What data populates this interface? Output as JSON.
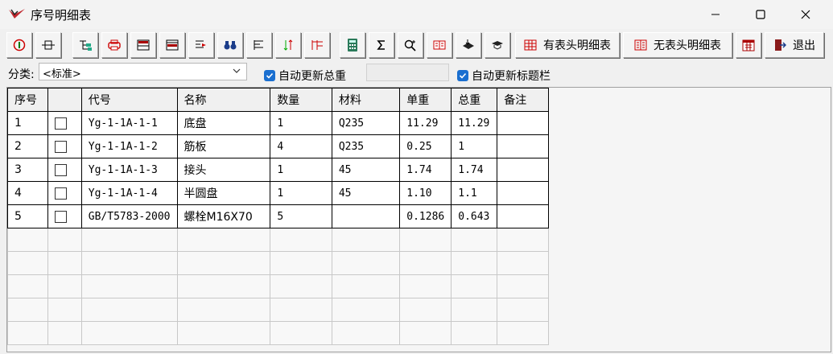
{
  "window": {
    "title": "序号明细表"
  },
  "toolbar": {
    "with_header_label": "有表头明细表",
    "no_header_label": "无表头明细表",
    "exit_label": "退出"
  },
  "filter": {
    "category_label": "分类:",
    "category_value": "<标准>",
    "auto_update_total_label": "自动更新总重",
    "auto_update_title_label": "自动更新标题栏"
  },
  "table": {
    "columns": [
      "序号",
      "",
      "代号",
      "名称",
      "数量",
      "材料",
      "单重",
      "总重",
      "备注"
    ],
    "rows": [
      [
        "1",
        "",
        "Yg-1-1A-1-1",
        "底盘",
        "1",
        "Q235",
        "11.29",
        "11.29",
        ""
      ],
      [
        "2",
        "",
        "Yg-1-1A-1-2",
        "筋板",
        "4",
        "Q235",
        "0.25",
        "1",
        ""
      ],
      [
        "3",
        "",
        "Yg-1-1A-1-3",
        "接头",
        "1",
        "45",
        "1.74",
        "1.74",
        ""
      ],
      [
        "4",
        "",
        "Yg-1-1A-1-4",
        "半圆盘",
        "1",
        "45",
        "1.10",
        "1.1",
        ""
      ],
      [
        "5",
        "",
        "GB/T5783-2000",
        "螺栓M16X70",
        "5",
        "",
        "0.1286",
        "0.643",
        ""
      ]
    ]
  }
}
